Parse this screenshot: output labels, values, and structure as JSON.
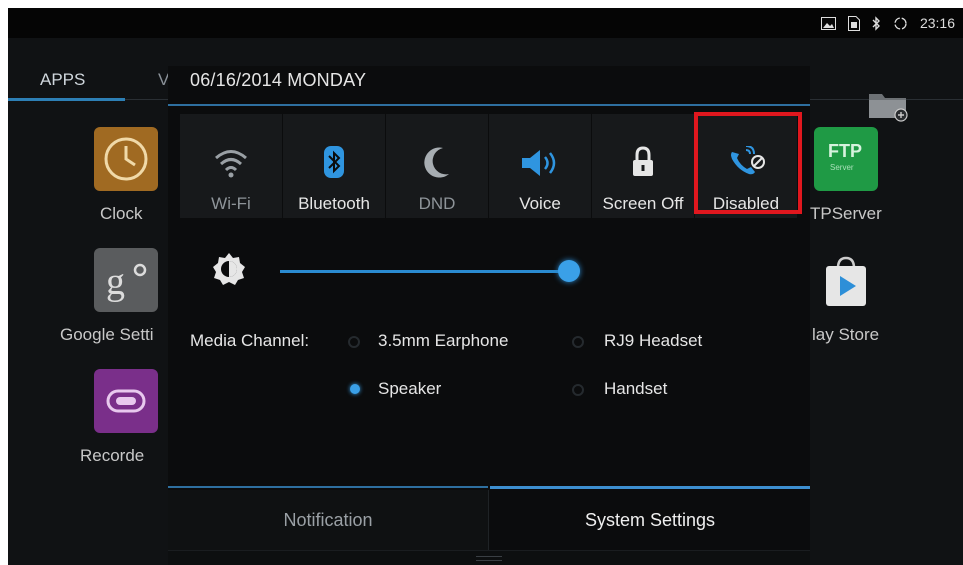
{
  "status_bar": {
    "time": "23:16",
    "icons": [
      "image-icon",
      "sim-icon",
      "bluetooth-icon",
      "sync-icon"
    ]
  },
  "launcher": {
    "tab_apps": "APPS",
    "tab_partial": "V",
    "left_apps": [
      {
        "label": "Clock",
        "icon": "clock-icon"
      },
      {
        "label": "Google Setti",
        "icon": "google-settings-icon"
      },
      {
        "label": "Recorde",
        "icon": "recorder-icon"
      }
    ],
    "right_apps": [
      {
        "label": "TPServer",
        "icon": "ftp-server-icon",
        "icon_text": "FTP",
        "icon_subtext": "Server"
      },
      {
        "label": "lay Store",
        "icon": "play-store-icon"
      }
    ],
    "folder_icon": "folder-add-icon"
  },
  "panel": {
    "date": "06/16/2014 MONDAY",
    "tiles": [
      {
        "label": "Wi-Fi",
        "icon": "wifi-icon",
        "active": false
      },
      {
        "label": "Bluetooth",
        "icon": "bluetooth-icon",
        "active": true
      },
      {
        "label": "DND",
        "icon": "moon-icon",
        "active": false
      },
      {
        "label": "Voice",
        "icon": "speaker-icon",
        "active": true
      },
      {
        "label": "Screen Off",
        "icon": "lock-icon",
        "active": true
      },
      {
        "label": "Disabled",
        "icon": "call-disabled-icon",
        "active": true
      }
    ],
    "brightness_level": 0.97,
    "media_channel": {
      "label": "Media Channel:",
      "options": [
        {
          "label": "3.5mm Earphone",
          "selected": false
        },
        {
          "label": "RJ9 Headset",
          "selected": false
        },
        {
          "label": "Speaker",
          "selected": true
        },
        {
          "label": "Handset",
          "selected": false
        }
      ]
    },
    "bottom_tabs": {
      "notification": "Notification",
      "system_settings": "System Settings"
    }
  },
  "colors": {
    "accent": "#3aa0e8",
    "highlight": "#e0171e",
    "tile_bg": "#17191b",
    "active_text": "#e6e6e6",
    "inactive_text": "#8e9499"
  }
}
